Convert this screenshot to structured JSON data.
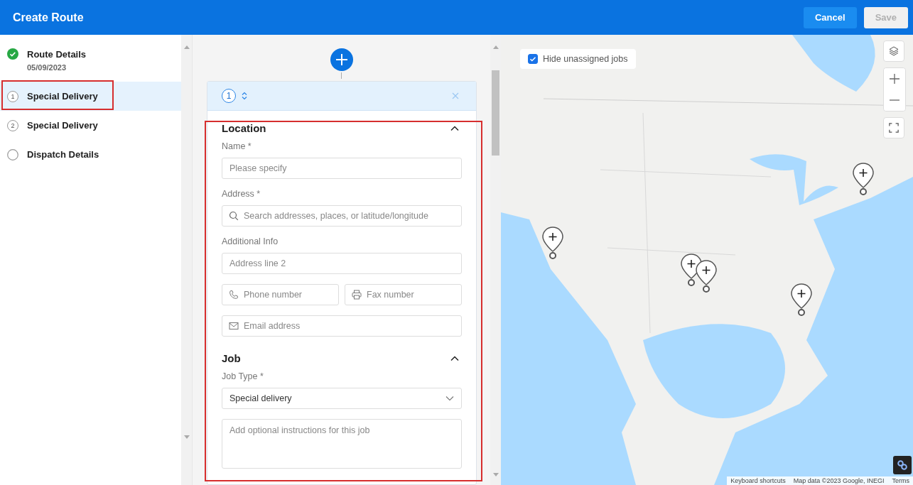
{
  "header": {
    "title": "Create Route",
    "buttons": [
      {
        "kind": "primary",
        "label": "Cancel",
        "disabled": false
      },
      {
        "kind": "secondary",
        "label": "Save",
        "disabled": true
      }
    ]
  },
  "steps": [
    {
      "kind": "done",
      "label": "Route Details",
      "subtitle": "05/09/2023",
      "selected": false
    },
    {
      "kind": "numbered",
      "number": "1",
      "label": "Special Delivery",
      "selected": true
    },
    {
      "kind": "numbered",
      "number": "2",
      "label": "Special Delivery",
      "selected": false
    },
    {
      "kind": "empty",
      "label": "Dispatch Details",
      "selected": false
    }
  ],
  "stop_card": {
    "number": "1",
    "sections": [
      {
        "title": "Location",
        "expanded": true,
        "fields": [
          {
            "label": "Name *",
            "inputs": [
              {
                "kind": "text",
                "placeholder": "Please specify"
              }
            ]
          },
          {
            "label": "Address *",
            "inputs": [
              {
                "kind": "search",
                "placeholder": "Search addresses, places, or latitude/longitude"
              }
            ]
          },
          {
            "label": "Additional Info",
            "inputs": [
              {
                "kind": "text",
                "placeholder": "Address line 2"
              }
            ]
          },
          {
            "inputs": [
              {
                "kind": "phone",
                "placeholder": "Phone number"
              },
              {
                "kind": "fax",
                "placeholder": "Fax number"
              }
            ]
          },
          {
            "inputs": [
              {
                "kind": "email",
                "placeholder": "Email address"
              }
            ]
          }
        ]
      },
      {
        "title": "Job",
        "expanded": true,
        "fields": [
          {
            "label": "Job Type *",
            "inputs": [
              {
                "kind": "select",
                "value": "Special delivery"
              }
            ]
          },
          {
            "inputs": [
              {
                "kind": "textarea",
                "placeholder": "Add optional instructions for this job"
              }
            ]
          }
        ]
      }
    ]
  },
  "map": {
    "hide_unassigned": {
      "label": "Hide unassigned jobs",
      "checked": true
    },
    "attribution": [
      "Keyboard shortcuts",
      "Map data ©2023 Google, INEGI",
      "Terms"
    ]
  }
}
